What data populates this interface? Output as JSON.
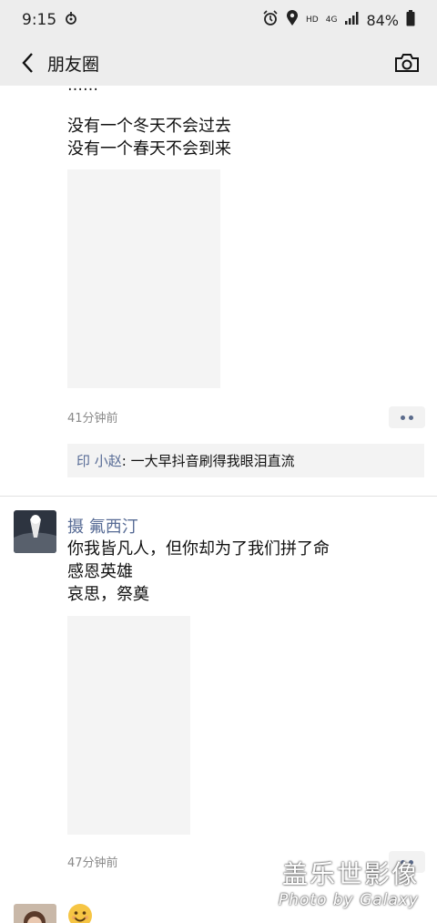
{
  "status_bar": {
    "time": "9:15",
    "network_hd": "HD",
    "network_4g": "4G",
    "battery": "84%"
  },
  "nav": {
    "title": "朋友圈"
  },
  "posts": [
    {
      "clipped_text": "……",
      "lines": "没有一个冬天不会过去\n没有一个春天不会到来",
      "time": "41分钟前",
      "comments": [
        {
          "name": "印 小赵",
          "separator": ": ",
          "text": "一大早抖音刷得我眼泪直流"
        }
      ]
    },
    {
      "author": "摄  氟西汀",
      "lines": "你我皆凡人，但你却为了我们拼了命\n感恩英雄\n哀思，祭奠",
      "time": "47分钟前"
    }
  ],
  "watermark": {
    "line1": "盖乐世影像",
    "line2": "Photo by Galaxy"
  },
  "colors": {
    "bar": "#ededed",
    "link": "#576b95",
    "image_placeholder": "#f4f4f4"
  }
}
